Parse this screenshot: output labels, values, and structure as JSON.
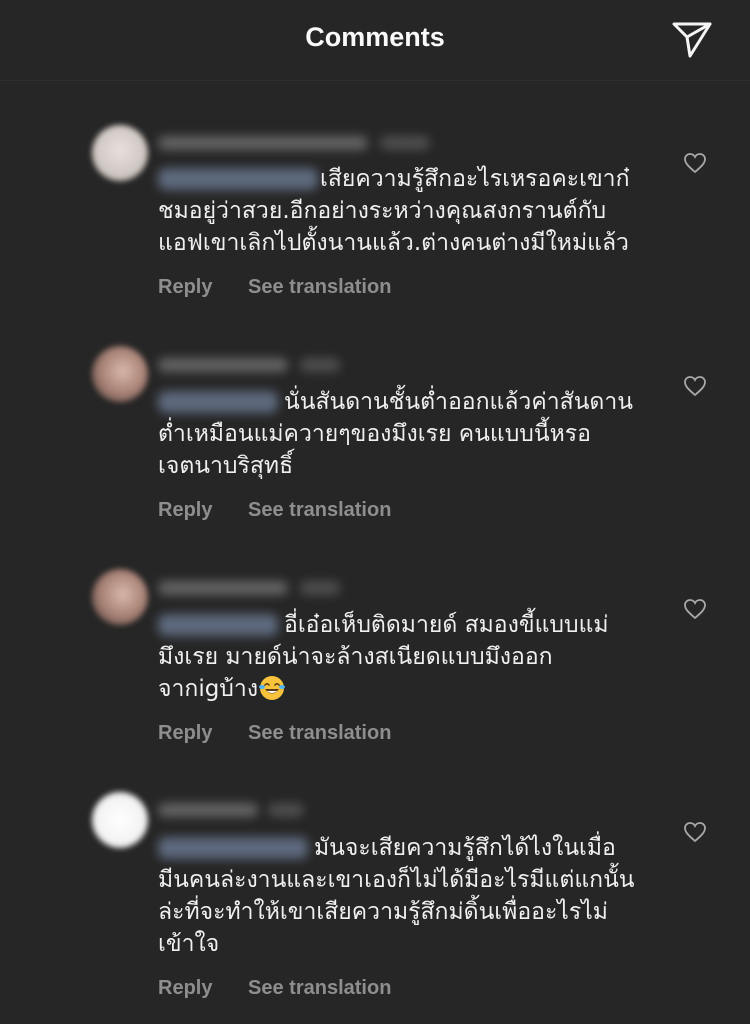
{
  "header": {
    "title": "Comments",
    "send_icon": "paper-plane-icon"
  },
  "comments": [
    {
      "lines": [
        "เสียความรู้สึกอะไรเหรอคะเขาก๋",
        "ชมอยู่ว่าสวย.อีกอย่างระหว่างคุณสงกรานต์กับ",
        "แอฟเขาเลิกไปตั้งนานแล้ว.ต่างคนต่างมีใหม่แล้ว"
      ],
      "reply": "Reply",
      "translate": "See translation"
    },
    {
      "lines": [
        "นั่นสันดานชั้นต่ำออกแล้วค่าสันดาน",
        "ต่ำเหมือนแม่ควายๆของมึงเรย คนแบบนี้หรอ",
        "เจตนาบริสุทธิ์"
      ],
      "reply": "Reply",
      "translate": "See translation"
    },
    {
      "lines": [
        "อี่เอ๋อเห็บติดมายด์ สมองขี้แบบแม่",
        "มึงเรย มายด์น่าจะล้างสเนียดแบบมึงออก",
        "จากigบ้าง"
      ],
      "emoji": "laughing-tears-emoji",
      "reply": "Reply",
      "translate": "See translation"
    },
    {
      "lines": [
        "มันจะเสียความรู้สึกได้ไงในเมื่อ",
        "มีนคนล่ะงานและเขาเองก็ไม่ได้มีอะไรมีแต่แกนั้น",
        "ล่ะที่จะทำให้เขาเสียความรู้สึกม่ดิ้นเพื่ออะไรไม่",
        "เข้าใจ"
      ],
      "reply": "Reply",
      "translate": "See translation"
    }
  ],
  "colors": {
    "background": "#262626",
    "text": "#f0f0f0",
    "muted": "#8e8e8e"
  }
}
